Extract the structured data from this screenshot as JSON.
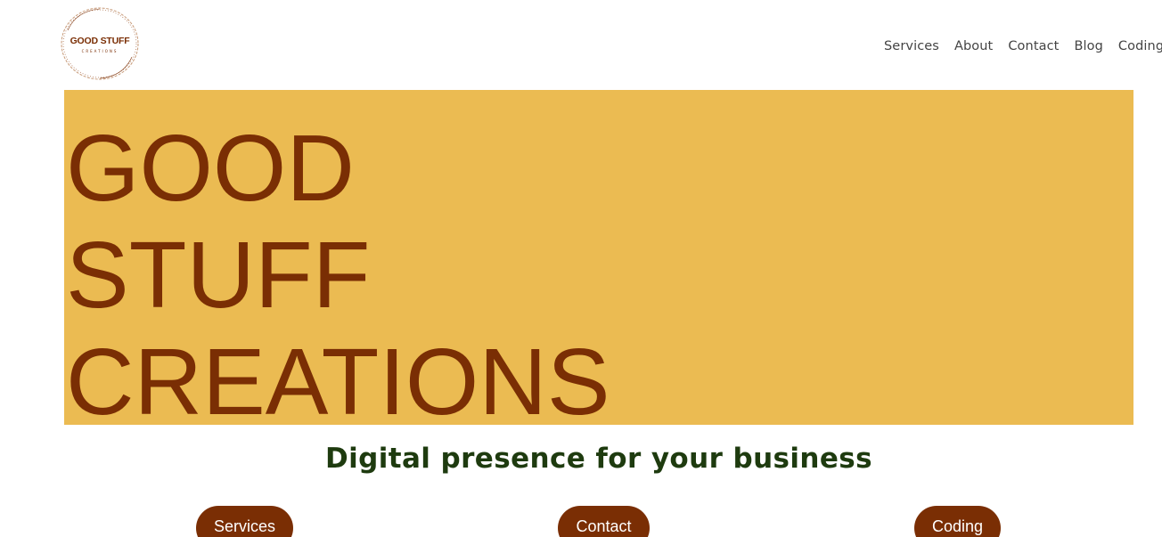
{
  "logo": {
    "title": "GOOD STUFF",
    "subtitle": "CREATIONS"
  },
  "nav": {
    "items": [
      {
        "label": "Services"
      },
      {
        "label": "About"
      },
      {
        "label": "Contact"
      },
      {
        "label": "Blog"
      },
      {
        "label": "Coding"
      }
    ]
  },
  "hero": {
    "lines": [
      "GOOD",
      "STUFF",
      "CREATIONS"
    ],
    "background_color": "#ebbb52",
    "text_color": "#7a2e04"
  },
  "tagline": "Digital presence for your business",
  "buttons": {
    "services": "Services",
    "contact": "Contact",
    "coding": "Coding",
    "color": "#7a2e04"
  }
}
